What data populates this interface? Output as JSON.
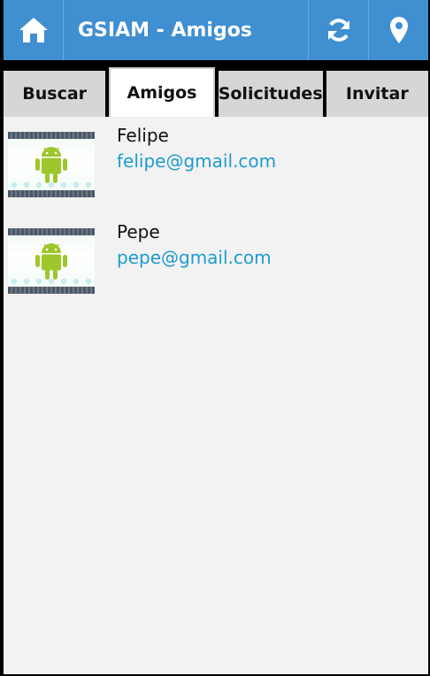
{
  "actionbar": {
    "title": "GSIAM - Amigos",
    "color": "#3f8fd1",
    "icons": [
      "home-icon",
      "refresh-icon",
      "location-pin-icon"
    ]
  },
  "tabs": [
    {
      "label": "Buscar",
      "active": false
    },
    {
      "label": "Amigos",
      "active": true
    },
    {
      "label": "Solicitudes",
      "active": false
    },
    {
      "label": "Invitar",
      "active": false
    }
  ],
  "friends": [
    {
      "name": "Felipe",
      "email": "felipe@gmail.com",
      "avatar_icon": "android-icon"
    },
    {
      "name": "Pepe",
      "email": "pepe@gmail.com",
      "avatar_icon": "android-icon"
    }
  ],
  "colors": {
    "accent": "#3f8fd1",
    "link": "#1e9ccf",
    "android": "#9dc62b"
  }
}
